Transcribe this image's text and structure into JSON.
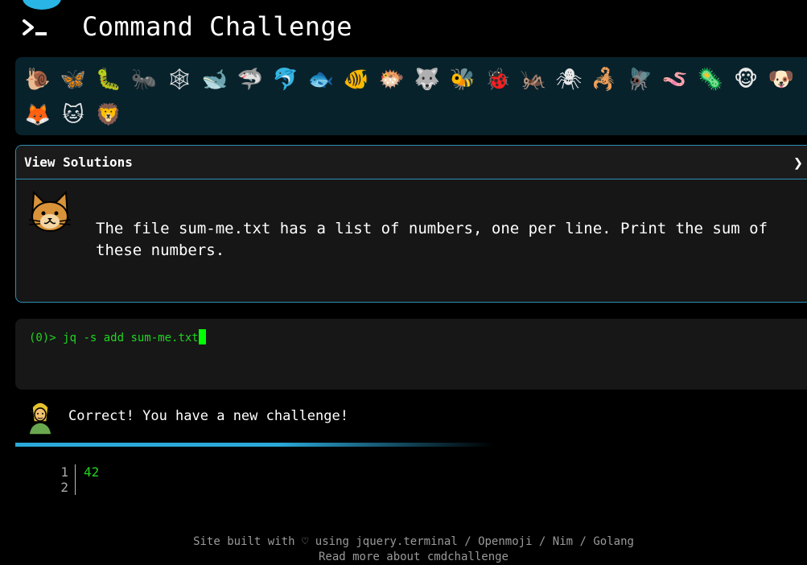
{
  "header": {
    "title": "Command Challenge"
  },
  "emoji_bar": {
    "items": [
      {
        "name": "snail",
        "glyph": "🐌"
      },
      {
        "name": "butterfly",
        "glyph": "🦋"
      },
      {
        "name": "caterpillar",
        "glyph": "🐛"
      },
      {
        "name": "ant",
        "glyph": "🐜"
      },
      {
        "name": "spider-web",
        "glyph": "🕸"
      },
      {
        "name": "whale",
        "glyph": "🐋"
      },
      {
        "name": "shark",
        "glyph": "🦈"
      },
      {
        "name": "dolphin",
        "glyph": "🐬"
      },
      {
        "name": "fish",
        "glyph": "🐟"
      },
      {
        "name": "tropical-fish",
        "glyph": "🐠"
      },
      {
        "name": "blowfish",
        "glyph": "🐡"
      },
      {
        "name": "wolf",
        "glyph": "🐺"
      },
      {
        "name": "bee",
        "glyph": "🐝"
      },
      {
        "name": "lady-beetle",
        "glyph": "🐞"
      },
      {
        "name": "cricket",
        "glyph": "🦗"
      },
      {
        "name": "spider",
        "glyph": "🕷"
      },
      {
        "name": "scorpion",
        "glyph": "🦂"
      },
      {
        "name": "fly",
        "glyph": "🪰"
      },
      {
        "name": "worm",
        "glyph": "🪱"
      },
      {
        "name": "microbe",
        "glyph": "🦠"
      },
      {
        "name": "monkey",
        "glyph": "🐵"
      },
      {
        "name": "dog",
        "glyph": "🐶"
      },
      {
        "name": "fox",
        "glyph": "🦊"
      },
      {
        "name": "cat",
        "glyph": "🐱"
      },
      {
        "name": "lion",
        "glyph": "🦁"
      }
    ]
  },
  "challenge": {
    "solutions_label": "View Solutions",
    "chevron": "❯",
    "text": "The file sum-me.txt has a list of numbers, one per line. Print the sum of these numbers."
  },
  "terminal": {
    "prompt": "(0)> ",
    "command": "jq -s add  sum-me.txt"
  },
  "result": {
    "message": "Correct! You have a new challenge!"
  },
  "output": {
    "line_numbers": [
      "1",
      "2"
    ],
    "lines": [
      "42",
      ""
    ]
  },
  "footer": {
    "line1": "Site built with ♡ using jquery.terminal / Openmoji / Nim / Golang",
    "line2": "Read more about cmdchallenge"
  },
  "colors": {
    "accent": "#2aa8d8",
    "terminal_green": "#22d422",
    "emoji_bar_bg": "#08222c"
  }
}
